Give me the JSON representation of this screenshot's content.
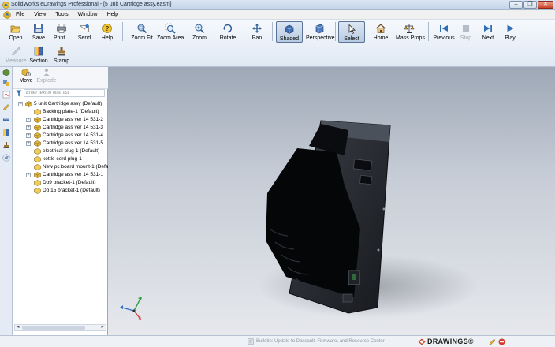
{
  "window": {
    "title": "SolidWorks eDrawings Professional - [5 unit Cartridge assy.easm]",
    "buttons": [
      "minimize",
      "restore",
      "close"
    ]
  },
  "menu": {
    "items": [
      "File",
      "View",
      "Tools",
      "Window",
      "Help"
    ]
  },
  "toolbar": {
    "row1": [
      {
        "label": "Open",
        "icon": "folder-open-icon"
      },
      {
        "label": "Save",
        "icon": "floppy-icon"
      },
      {
        "label": "Print...",
        "icon": "printer-icon"
      },
      {
        "label": "Send",
        "icon": "envelope-icon"
      },
      {
        "label": "Help",
        "icon": "help-icon"
      },
      {
        "label": "Zoom Fit",
        "icon": "zoom-fit-icon"
      },
      {
        "label": "Zoom Area",
        "icon": "zoom-area-icon"
      },
      {
        "label": "Zoom",
        "icon": "zoom-icon"
      },
      {
        "label": "Rotate",
        "icon": "rotate-icon"
      },
      {
        "label": "Pan",
        "icon": "pan-icon"
      },
      {
        "label": "Shaded",
        "icon": "shaded-icon",
        "active": true
      },
      {
        "label": "Perspective",
        "icon": "perspective-icon"
      },
      {
        "label": "Select",
        "icon": "select-icon",
        "active": true
      },
      {
        "label": "Home",
        "icon": "home-icon"
      },
      {
        "label": "Mass Props",
        "icon": "mass-props-icon"
      },
      {
        "label": "Previous",
        "icon": "previous-icon"
      },
      {
        "label": "Stop",
        "icon": "stop-icon",
        "disabled": true
      },
      {
        "label": "Next",
        "icon": "next-icon"
      },
      {
        "label": "Play",
        "icon": "play-icon"
      }
    ],
    "row2": [
      {
        "label": "Measure",
        "icon": "measure-icon",
        "disabled": true
      },
      {
        "label": "Section",
        "icon": "section-icon"
      },
      {
        "label": "Stamp",
        "icon": "stamp-icon"
      }
    ]
  },
  "panel": {
    "tools": [
      {
        "label": "Move",
        "icon": "move-icon"
      },
      {
        "label": "Explode",
        "icon": "explode-icon",
        "disabled": true
      }
    ],
    "filter_placeholder": "Enter text to filter list",
    "tree": [
      {
        "label": "5 unit Cartridge assy (Default)",
        "level": 0,
        "expander": "−"
      },
      {
        "label": "Backing plate-1 (Default)",
        "level": 1,
        "expander": ""
      },
      {
        "label": "Cartridge ass ver 14 531-2",
        "level": 1,
        "expander": "+"
      },
      {
        "label": "Cartridge ass ver 14 531-3",
        "level": 1,
        "expander": "+"
      },
      {
        "label": "Cartridge ass ver 14 531-4",
        "level": 1,
        "expander": "+"
      },
      {
        "label": "Cartridge ass ver 14 531-5",
        "level": 1,
        "expander": "+"
      },
      {
        "label": "electrical plug-1 (Default)",
        "level": 1,
        "expander": ""
      },
      {
        "label": "kettle cord plug-1",
        "level": 1,
        "expander": ""
      },
      {
        "label": "New pc board mount-1 (Default)",
        "level": 1,
        "expander": ""
      },
      {
        "label": "Cartridge ass ver 14 531-1",
        "level": 1,
        "expander": "+"
      },
      {
        "label": "Db9 bracket-1 (Default)",
        "level": 1,
        "expander": ""
      },
      {
        "label": "Db 15 bracket-1 (Default)",
        "level": 1,
        "expander": ""
      }
    ]
  },
  "status": {
    "message": "Bulletin: Update to Dassault, Firmware, and Resource Center",
    "brand": "DRAWINGS®"
  },
  "colors": {
    "accent": "#3b6aa8",
    "viewport_top": "#9ea8b6",
    "viewport_bottom": "#e6e8ec"
  }
}
